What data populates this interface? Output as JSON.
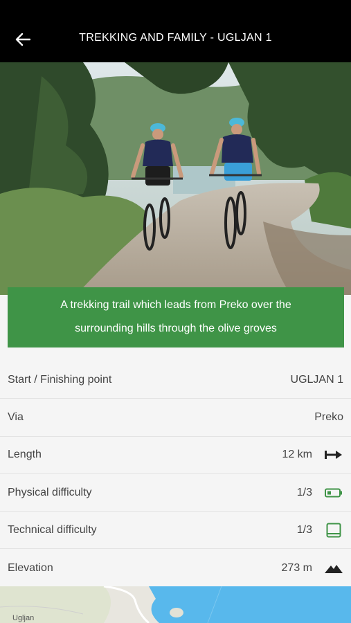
{
  "header": {
    "title": "TREKKING AND FAMILY - UGLJAN 1",
    "back_icon": "arrow-left-icon"
  },
  "hero": {
    "image": "two-cyclists-on-gravel-trail"
  },
  "description": {
    "line1": "A trekking trail which leads from Preko over the",
    "line2": "surrounding hills through the olive groves",
    "background": "#3f9447"
  },
  "details": [
    {
      "label": "Start / Finishing point",
      "value": "UGLJAN 1",
      "icon": ""
    },
    {
      "label": "Via",
      "value": "Preko",
      "icon": ""
    },
    {
      "label": "Length",
      "value": "12 km",
      "icon": "arrow-right-bar-icon"
    },
    {
      "label": "Physical difficulty",
      "value": "1/3",
      "icon": "battery-icon"
    },
    {
      "label": "Technical difficulty",
      "value": "1/3",
      "icon": "book-icon"
    },
    {
      "label": "Elevation",
      "value": "273 m",
      "icon": "mountain-icon"
    }
  ],
  "map": {
    "place_label": "Ugljan"
  },
  "colors": {
    "accent_green": "#3f9447",
    "header_bg": "#000000",
    "sea": "#58b8ec"
  }
}
